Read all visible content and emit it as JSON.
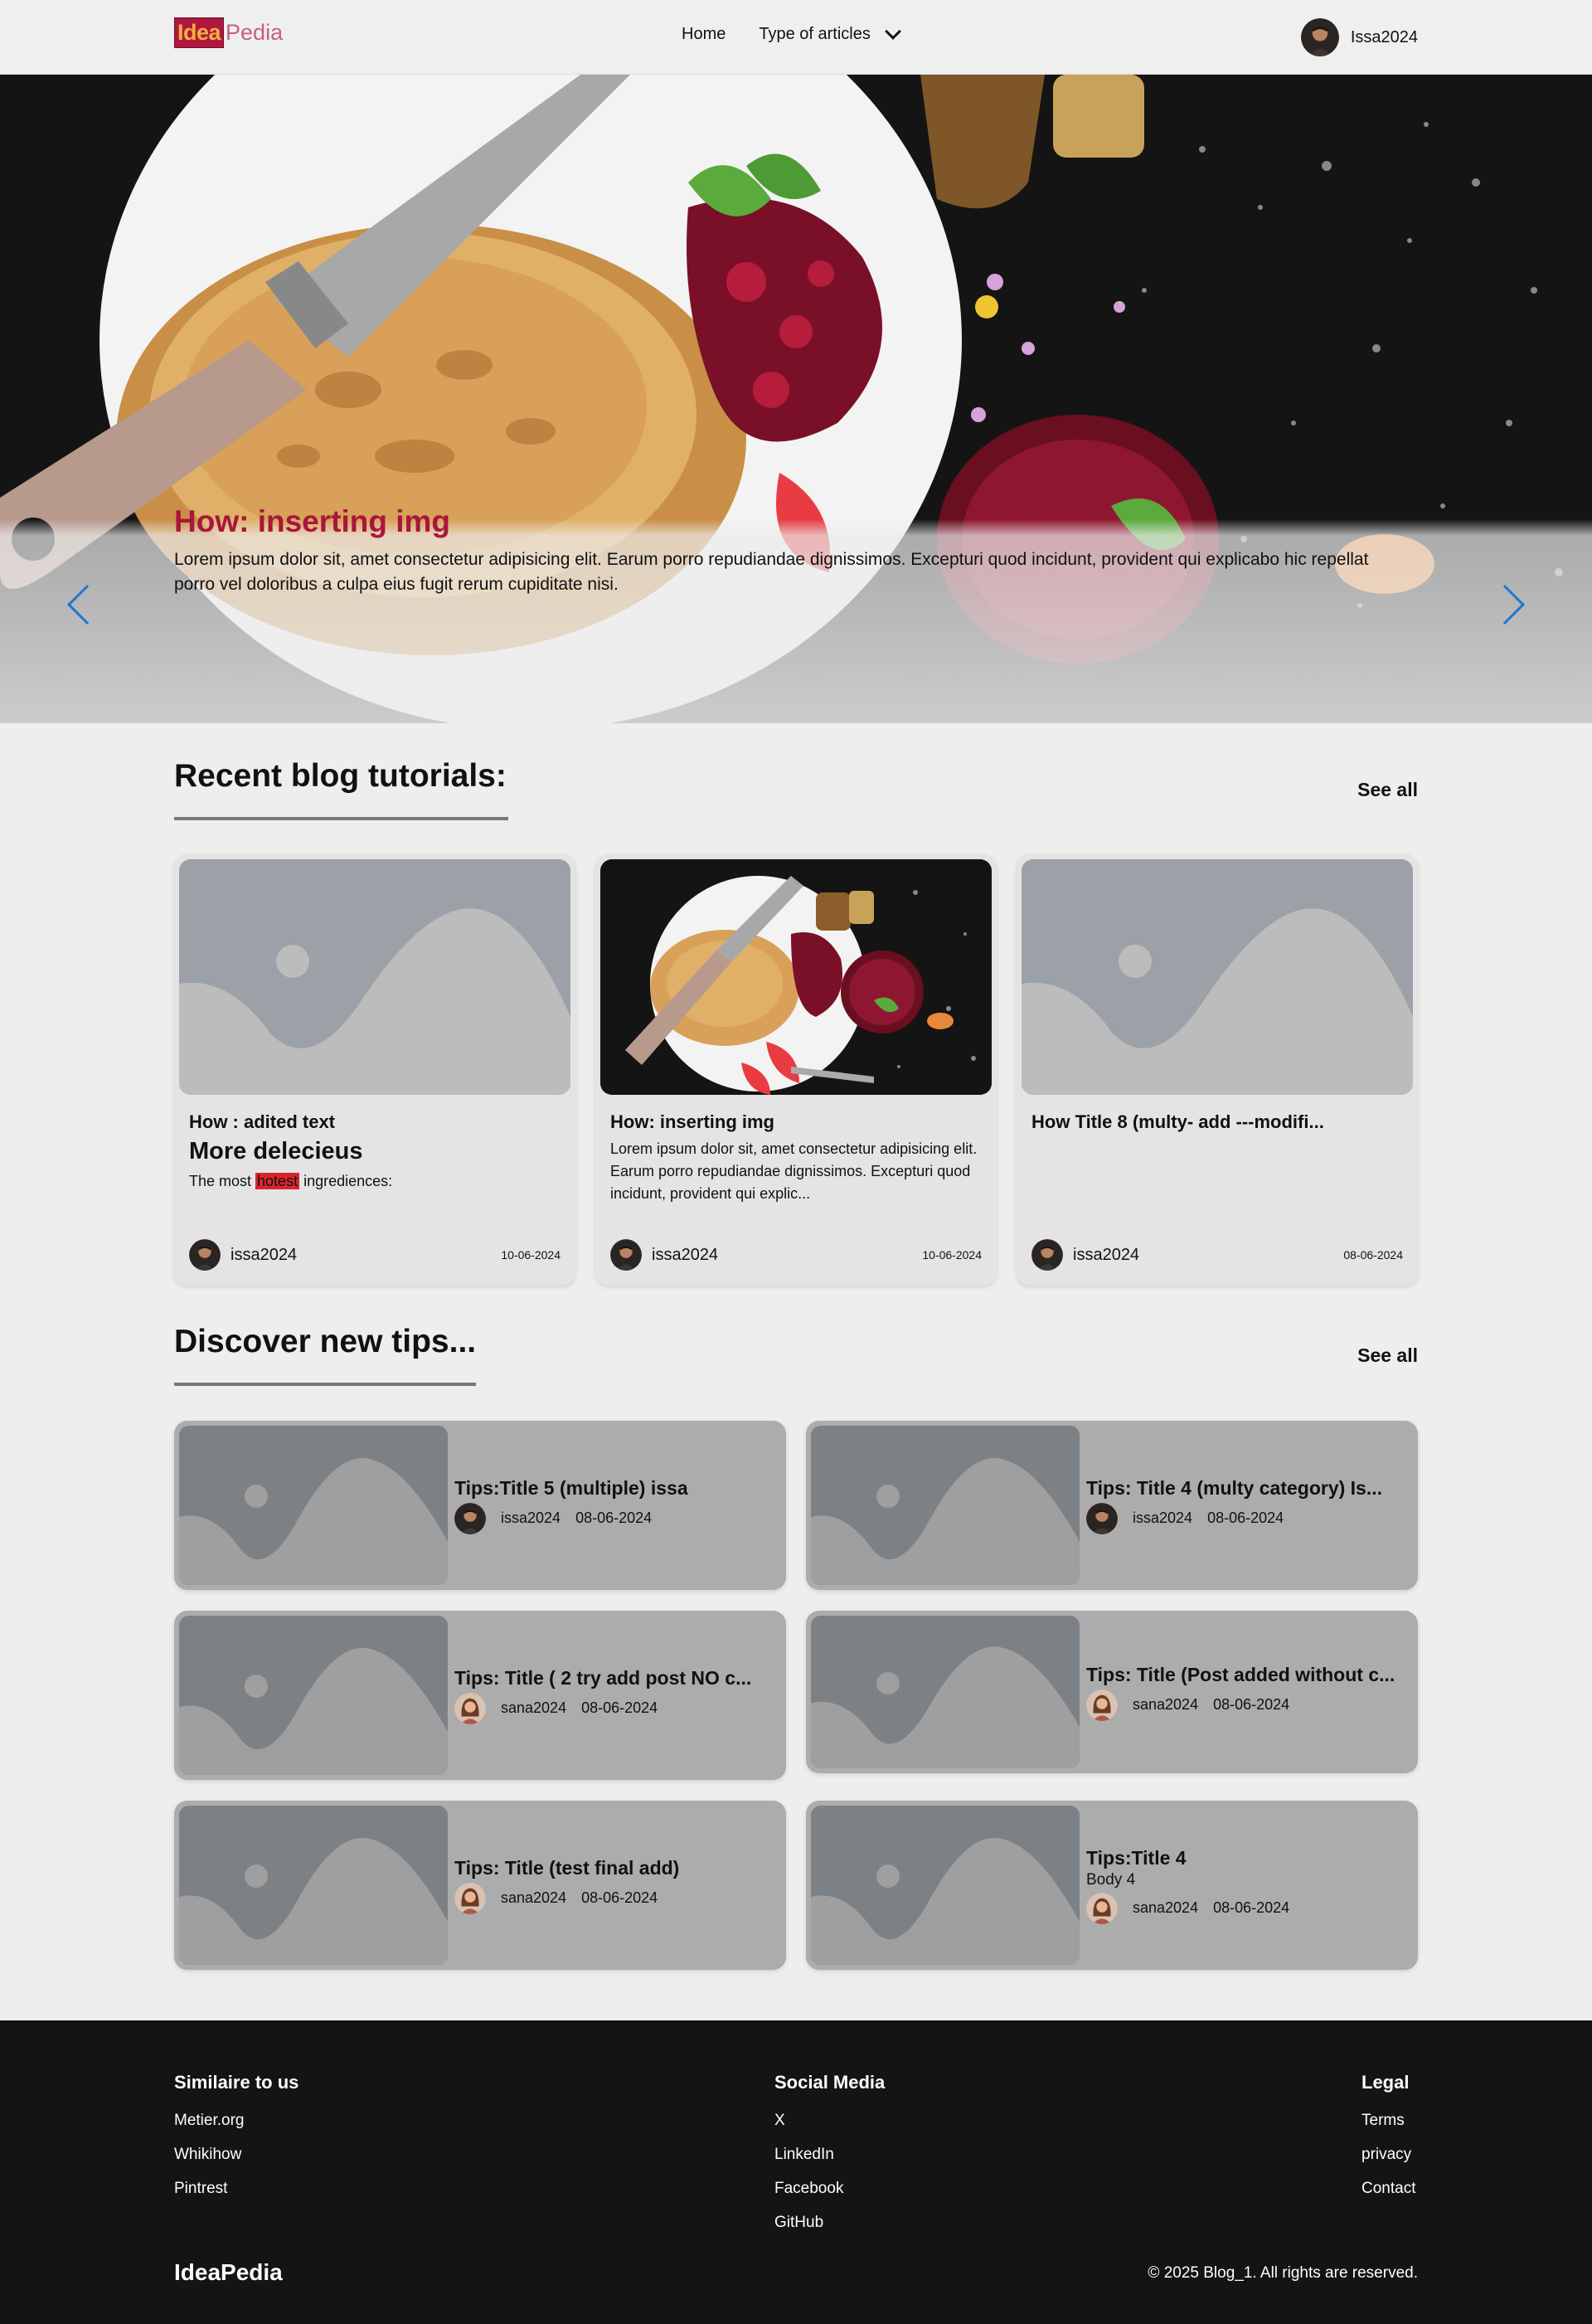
{
  "brand": {
    "logo_part1": "Idea",
    "logo_part2": "Pedia",
    "accent": "#a8163a"
  },
  "nav": {
    "home": "Home",
    "types": "Type of articles"
  },
  "user": {
    "name": "Issa2024"
  },
  "hero": {
    "title": "How: inserting img",
    "text": "Lorem ipsum dolor sit, amet consectetur adipisicing elit. Earum porro repudiandae dignissimos. Excepturi quod incidunt, provident qui explicabo hic repellat porro vel doloribus a culpa eius fugit rerum cupiditate nisi."
  },
  "recent": {
    "title": "Recent blog tutorials:",
    "see_all": "See all",
    "cards": [
      {
        "title": "How : adited text",
        "subtitle": "More delecieus",
        "text_before": "The most ",
        "highlight": "hotest",
        "text_after": " ingrediences:",
        "author": "issa2024",
        "date": "10-06-2024"
      },
      {
        "title": "How: inserting img",
        "text": "Lorem ipsum dolor sit, amet consectetur adipisicing elit. Earum porro repudiandae dignissimos. Excepturi quod incidunt, provident qui explic...",
        "author": "issa2024",
        "date": "10-06-2024"
      },
      {
        "title": "How Title 8 (multy- add ---modifi...",
        "author": "issa2024",
        "date": "08-06-2024"
      }
    ]
  },
  "tips": {
    "title": "Discover new tips...",
    "see_all": "See all",
    "items": [
      {
        "title": "Tips:Title 5 (multiple) issa",
        "author": "issa2024",
        "date": "08-06-2024"
      },
      {
        "title": "Tips: Title 4 (multy category) Is...",
        "author": "issa2024",
        "date": "08-06-2024"
      },
      {
        "title": "Tips: Title ( 2 try add post NO c...",
        "author": "sana2024",
        "date": "08-06-2024"
      },
      {
        "title": "Tips: Title (Post added without c...",
        "author": "sana2024",
        "date": "08-06-2024"
      },
      {
        "title": "Tips: Title (test final add)",
        "author": "sana2024",
        "date": "08-06-2024"
      },
      {
        "title": "Tips:Title 4",
        "body": "Body 4",
        "author": "sana2024",
        "date": "08-06-2024"
      }
    ]
  },
  "footer": {
    "col1": {
      "title": "Similaire to us",
      "links": [
        "Metier.org",
        "Whikihow",
        "Pintrest"
      ]
    },
    "col2": {
      "title": "Social Media",
      "links": [
        "X",
        "LinkedIn",
        "Facebook",
        "GitHub"
      ]
    },
    "col3": {
      "title": "Legal",
      "links": [
        "Terms",
        "privacy",
        "Contact"
      ]
    },
    "brand": "IdeaPedia",
    "copyright": "© 2025 Blog_1. All rights are reserved."
  }
}
